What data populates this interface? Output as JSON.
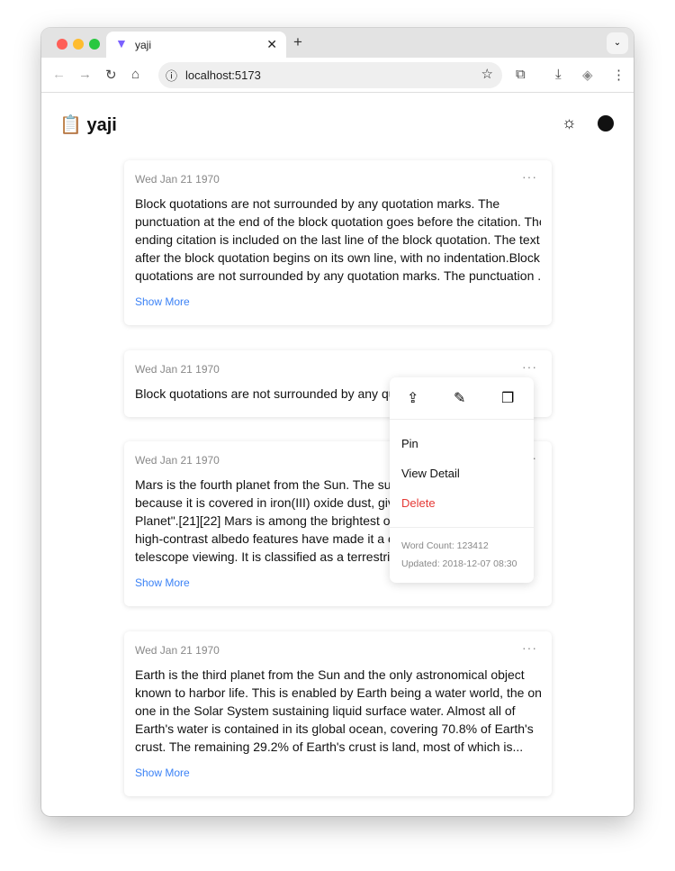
{
  "browser": {
    "tab_title": "yaji",
    "url": "localhost:5173"
  },
  "app": {
    "title": "yaji",
    "logo_emoji": "📋"
  },
  "cards": [
    {
      "date": "Wed Jan 21 1970",
      "lines": [
        "Block quotations are not surrounded by any quotation marks. The",
        "punctuation at the end of the block quotation goes before the citation. The",
        "ending citation is included on the last line of the block quotation. The text",
        "after the block quotation begins on its own line, with no indentation.Block",
        "quotations are not surrounded by any quotation marks. The punctuation ..."
      ],
      "show_more": "Show More"
    },
    {
      "date": "Wed Jan 21 1970",
      "lines": [
        "Block quotations are not surrounded by any quo"
      ]
    },
    {
      "date": "Wed Jan 21 1970",
      "lines": [
        "Mars is the fourth planet from the Sun. The surf",
        "because it is covered in iron(III) oxide dust, givi",
        "Planet\".[21][22] Mars is among the brightest ob",
        "high-contrast albedo features have made it a co",
        "telescope viewing. It is classified as a terrestria"
      ],
      "show_more": "Show More"
    },
    {
      "date": "Wed Jan 21 1970",
      "lines": [
        "Earth is the third planet from the Sun and the only astronomical object",
        "known to harbor life. This is enabled by Earth being a water world, the only",
        "one in the Solar System sustaining liquid surface water. Almost all of",
        "Earth's water is contained in its global ocean, covering 70.8% of Earth's",
        "crust. The remaining 29.2% of Earth's crust is land, most of which is..."
      ],
      "show_more": "Show More"
    }
  ],
  "menu": {
    "icons": [
      "share-icon",
      "edit-icon",
      "copy-icon"
    ],
    "items": [
      "Pin",
      "View Detail",
      "Delete"
    ],
    "word_count": "Word Count: 123412",
    "updated": "Updated: 2018-12-07 08:30"
  },
  "colors": {
    "link": "#3b82f6",
    "danger": "#e53935"
  }
}
